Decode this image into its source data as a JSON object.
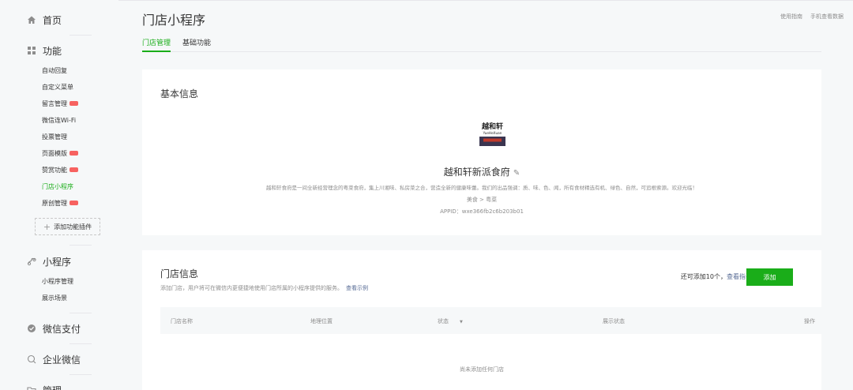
{
  "sidebar": {
    "home": "首页",
    "features": "功能",
    "feature_items": [
      "自动回复",
      "自定义菜单",
      "留言管理",
      "微信连Wi-Fi",
      "投票管理",
      "页面模版",
      "赞赏功能",
      "门店小程序",
      "原创管理"
    ],
    "add_plugin": "添加功能插件",
    "miniprogram": "小程序",
    "miniprogram_items": [
      "小程序管理",
      "展示场景"
    ],
    "wechat_pay": "微信支付",
    "work_wechat": "企业微信",
    "manage": "管理"
  },
  "header": {
    "title": "门店小程序",
    "links": [
      "使用指南",
      "手机查看数据"
    ],
    "tabs": [
      "门店管理",
      "基础功能"
    ]
  },
  "basic_info": {
    "title": "基本信息",
    "logo_text_cn": "越和轩",
    "logo_text_en": "YueHeXuan",
    "name": "越和轩新派食府",
    "description": "越和轩食府是一间全新经营理念的粤菜食府，集上川湘味、私房菜之合，营造全新的健康味蕾。我们的出品强调：质、味、色、闻，所有食材精选有机、绿色、自然，可追根索源。欢迎光临！",
    "category": "美食 > 粤菜",
    "appid": "APPID：wxe366fb2c6b203b01"
  },
  "store_info": {
    "title": "门店信息",
    "tip": "添加门店，用户将可在微信内更便捷地使用门店所属的小程序提供的服务。",
    "tip_link": "查看示例",
    "remaining": "还可添加10个，",
    "remaining_link": "查看指引",
    "add_button": "添加",
    "columns": [
      "门店名称",
      "地理位置",
      "状态",
      "展示状态",
      "操作"
    ],
    "empty": "尚未添加任何门店"
  },
  "colors": {
    "accent": "#1aad19",
    "link": "#576b95",
    "badge": "#f76260"
  }
}
